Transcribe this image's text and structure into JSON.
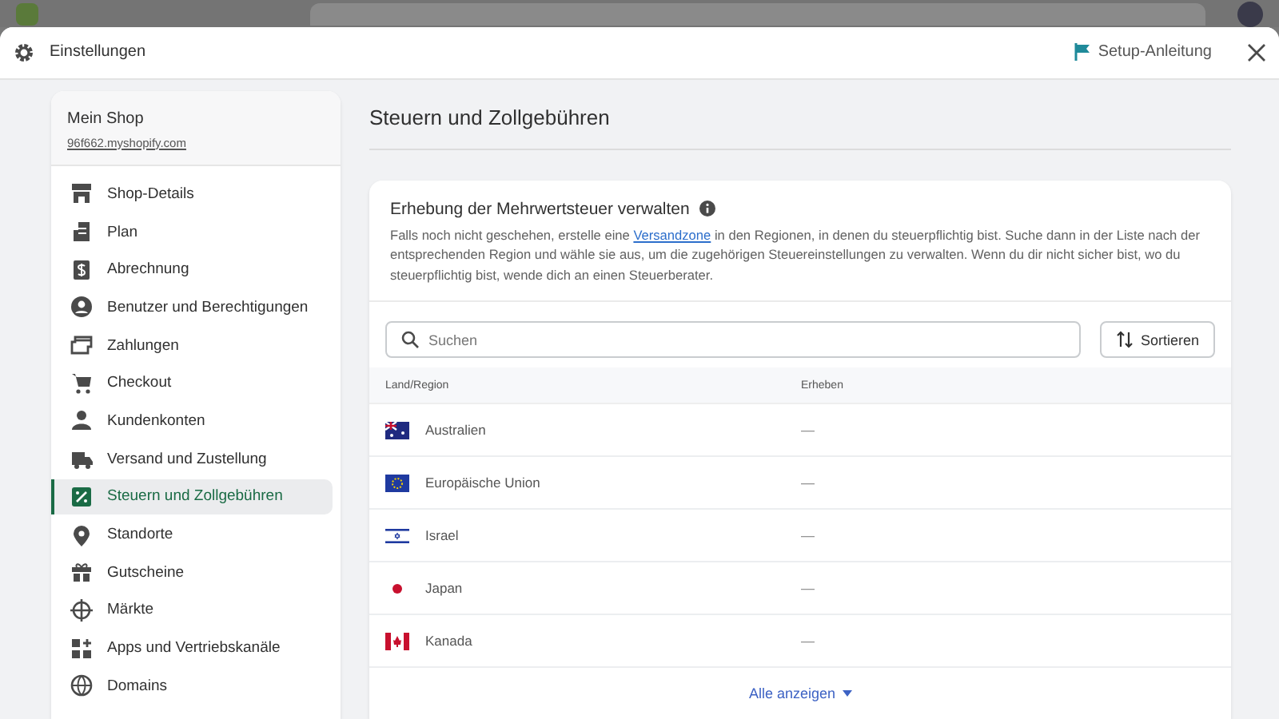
{
  "window": {
    "title": "Einstellungen",
    "setup_link": "Setup-Anleitung"
  },
  "sidebar": {
    "shop_name": "Mein Shop",
    "shop_domain": "96f662.myshopify.com",
    "items": [
      {
        "label": "Shop-Details",
        "selected": false
      },
      {
        "label": "Plan",
        "selected": false
      },
      {
        "label": "Abrechnung",
        "selected": false
      },
      {
        "label": "Benutzer und Berechtigungen",
        "selected": false
      },
      {
        "label": "Zahlungen",
        "selected": false
      },
      {
        "label": "Checkout",
        "selected": false
      },
      {
        "label": "Kundenkonten",
        "selected": false
      },
      {
        "label": "Versand und Zustellung",
        "selected": false
      },
      {
        "label": "Steuern und Zollgebühren",
        "selected": true
      },
      {
        "label": "Standorte",
        "selected": false
      },
      {
        "label": "Gutscheine",
        "selected": false
      },
      {
        "label": "Märkte",
        "selected": false
      },
      {
        "label": "Apps und Vertriebskanäle",
        "selected": false
      },
      {
        "label": "Domains",
        "selected": false
      }
    ]
  },
  "page": {
    "title": "Steuern und Zollgebühren",
    "card": {
      "title": "Erhebung der Mehrwertsteuer verwalten",
      "description_before": "Falls noch nicht geschehen, erstelle eine",
      "description_link": "Versandzone",
      "description_after": "in den Regionen, in denen du steuerpflichtig bist. Suche dann in der Liste nach der entsprechenden Region und wähle sie aus, um die zugehörigen Steuereinstellungen zu verwalten. Wenn du dir nicht sicher bist, wo du steuerpflichtig bist, wende dich an einen Steuerberater.",
      "search": {
        "placeholder": "Suchen"
      },
      "sort_button": "Sortieren",
      "table": {
        "columns": [
          "Land/Region",
          "Erheben"
        ],
        "rows": [
          {
            "region": "Australien",
            "collect": "—"
          },
          {
            "region": "Europäische Union",
            "collect": "—"
          },
          {
            "region": "Israel",
            "collect": "—"
          },
          {
            "region": "Japan",
            "collect": "—"
          },
          {
            "region": "Kanada",
            "collect": "—"
          }
        ]
      },
      "show_all": "Alle anzeigen"
    }
  }
}
